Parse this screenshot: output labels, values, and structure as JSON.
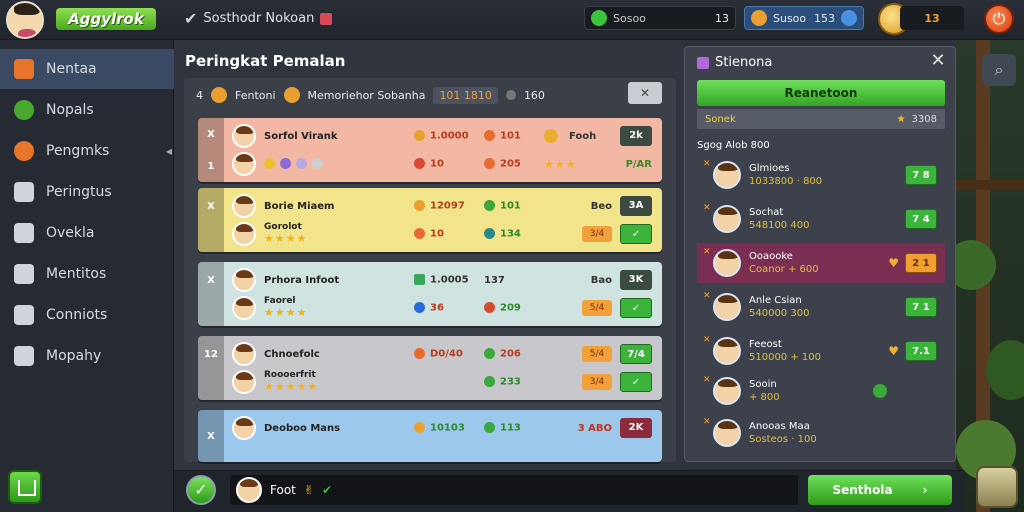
{
  "topbar": {
    "logo": "Aggylrok",
    "title": "Sosthodr Nokoan",
    "chip_a_label": "Sosoo",
    "chip_a_value": "13",
    "chip_b_label": "Susoo",
    "chip_b_value": "153",
    "chip_c_value": "13"
  },
  "sidebar": {
    "items": [
      {
        "label": "Nentaa",
        "color": "#e8762a"
      },
      {
        "label": "Nopals",
        "color": "#4aa82e"
      },
      {
        "label": "Pengmks",
        "color": "#e8762a"
      },
      {
        "label": "Peringtus",
        "color": "#cfd4dc"
      },
      {
        "label": "Ovekla",
        "color": "#cfd4dc"
      },
      {
        "label": "Mentitos",
        "color": "#cfd4dc"
      },
      {
        "label": "Conniots",
        "color": "#cfd4dc"
      },
      {
        "label": "Mopahy",
        "color": "#cfd4dc"
      }
    ]
  },
  "main": {
    "title": "Peringkat Pemalan",
    "head": {
      "rank": "4",
      "col1": "Fentoni",
      "col2": "Memoriehor Sobanha",
      "pill": "101 1810",
      "value": "160"
    },
    "cards": [
      {
        "bg": "#f2b8a4",
        "strip_top": "X",
        "strip_bot": "1",
        "r1_name": "Sorfol Virank",
        "r1_s1": "1.0000",
        "r1_s2": "101",
        "r1_tag": "Fooh",
        "r1_badge": "2k",
        "r2_s1": "10",
        "r2_s2": "205",
        "r2_stars": "★★★",
        "r2_tag": "P/AR"
      },
      {
        "bg": "#f2e48a",
        "strip_top": "X",
        "strip_bot": "",
        "r1_name": "Borie Miaem",
        "r1_s1": "12097",
        "r1_s2": "101",
        "r1_tag": "Beo",
        "r1_badge": "3A",
        "r2_name": "Gorolot",
        "r2_s1": "10",
        "r2_s2": "134",
        "r2_stars": "★★★★",
        "r2_tag": "3/4"
      },
      {
        "bg": "#cfe3e0",
        "strip_top": "X",
        "strip_bot": "",
        "r1_name": "Prhora Infoot",
        "r1_s1": "1.0005",
        "r1_s2": "137",
        "r1_tag": "Bao",
        "r1_badge": "3K",
        "r2_name": "Faorel",
        "r2_s1": "36",
        "r2_s2": "209",
        "r2_stars": "★★★★",
        "r2_tag": "5/4"
      },
      {
        "bg": "#c8c8cc",
        "strip_top": "12",
        "strip_bot": "",
        "r1_name": "Chnoefolc",
        "r1_s1": "D0/40",
        "r1_s2": "206",
        "r1_tag": "5/4",
        "r1_badge": "7/4",
        "r2_name": "Roooerfrit",
        "r2_s1": "",
        "r2_s2": "233",
        "r2_stars": "★★★★★",
        "r2_tag": "3/4"
      },
      {
        "bg": "#9cc8ec",
        "strip_top": "X",
        "strip_bot": "",
        "r1_name": "Deoboo Mans",
        "r1_s1": "10103",
        "r1_s2": "113",
        "r1_tag": "3 ABO",
        "r1_badge": "2K",
        "r2_name": "",
        "r2_s1": "",
        "r2_s2": "",
        "r2_stars": "",
        "r2_tag": ""
      }
    ]
  },
  "rpanel": {
    "title": "Stienona",
    "green": "Reanetoon",
    "sub_left": "Sonek",
    "sub_right": "3308",
    "head": "Sgog  Alob  800",
    "rows": [
      {
        "name": "Glmioes",
        "sub": "1033800 · 800",
        "score": "7 8",
        "hl": false,
        "orange": false
      },
      {
        "name": "Sochat",
        "sub": "548100 400",
        "score": "7 4",
        "hl": false,
        "orange": false
      },
      {
        "name": "Ooaooke",
        "sub": "Coanor + 600",
        "score": "2 1",
        "hl": true,
        "orange": true
      },
      {
        "name": "Anle Csian",
        "sub": "540000 300",
        "score": "7 1",
        "hl": false,
        "orange": false
      },
      {
        "name": "Feeost",
        "sub": "510000 + 100",
        "score": "7.1",
        "hl": false,
        "orange": false
      },
      {
        "name": "Sooin",
        "sub": "+ 800",
        "score": "",
        "hl": false,
        "orange": false
      },
      {
        "name": "Anooas Maa",
        "sub": "Sosteos · 100",
        "score": "",
        "hl": false,
        "orange": false
      }
    ]
  },
  "bottombar": {
    "chat": "Foot",
    "send_label": "Senthola"
  }
}
